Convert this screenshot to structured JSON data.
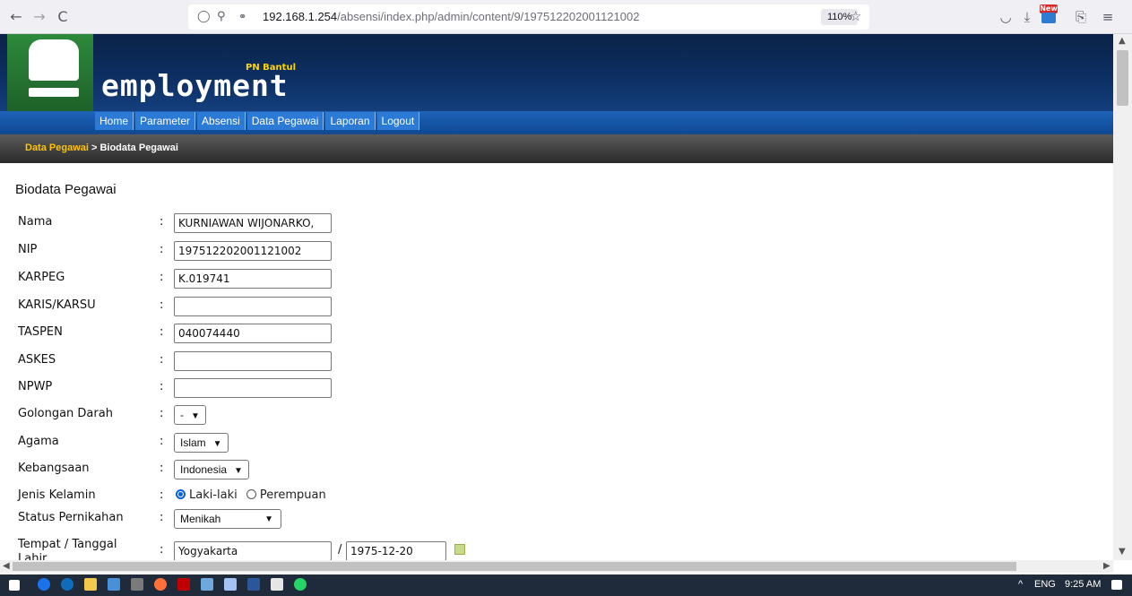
{
  "browser": {
    "back_icon": "←",
    "forward_icon": "→",
    "reload_icon": "C",
    "url_host": "192.168.1.254",
    "url_path": "/absensi/index.php/admin/content/9/197512202001121002",
    "zoom": "110%",
    "new_badge": "New"
  },
  "site": {
    "brand": "employment",
    "brand_sub": "PN Bantul",
    "menu": [
      "Home",
      "Parameter",
      "Absensi",
      "Data Pegawai",
      "Laporan",
      "Logout"
    ],
    "breadcrumb_link": "Data Pegawai",
    "breadcrumb_current": " > Biodata Pegawai"
  },
  "form": {
    "title": "Biodata Pegawai",
    "colon": ":",
    "fields": {
      "nama": {
        "label": "Nama",
        "value": "KURNIAWAN WIJONARKO,"
      },
      "nip": {
        "label": "NIP",
        "value": "197512202001121002"
      },
      "karpeg": {
        "label": "KARPEG",
        "value": "K.019741"
      },
      "karis": {
        "label": "KARIS/KARSU",
        "value": ""
      },
      "taspen": {
        "label": "TASPEN",
        "value": "040074440"
      },
      "askes": {
        "label": "ASKES",
        "value": ""
      },
      "npwp": {
        "label": "NPWP",
        "value": ""
      },
      "golongan_darah": {
        "label": "Golongan Darah",
        "selected": "-"
      },
      "agama": {
        "label": "Agama",
        "selected": "Islam"
      },
      "kebangsaan": {
        "label": "Kebangsaan",
        "selected": "Indonesia"
      },
      "jenis_kelamin": {
        "label": "Jenis Kelamin",
        "option_male": "Laki-laki",
        "option_female": "Perempuan",
        "checked": "male"
      },
      "status_pernikahan": {
        "label": "Status Pernikahan",
        "selected": "Menikah"
      },
      "ttl": {
        "label": "Tempat / Tanggal Lahir",
        "place": "Yogyakarta",
        "separator": "/",
        "date": "1975-12-20"
      }
    }
  },
  "taskbar": {
    "tray_chevron": "^",
    "lang": "ENG",
    "time": "9:25 AM"
  }
}
